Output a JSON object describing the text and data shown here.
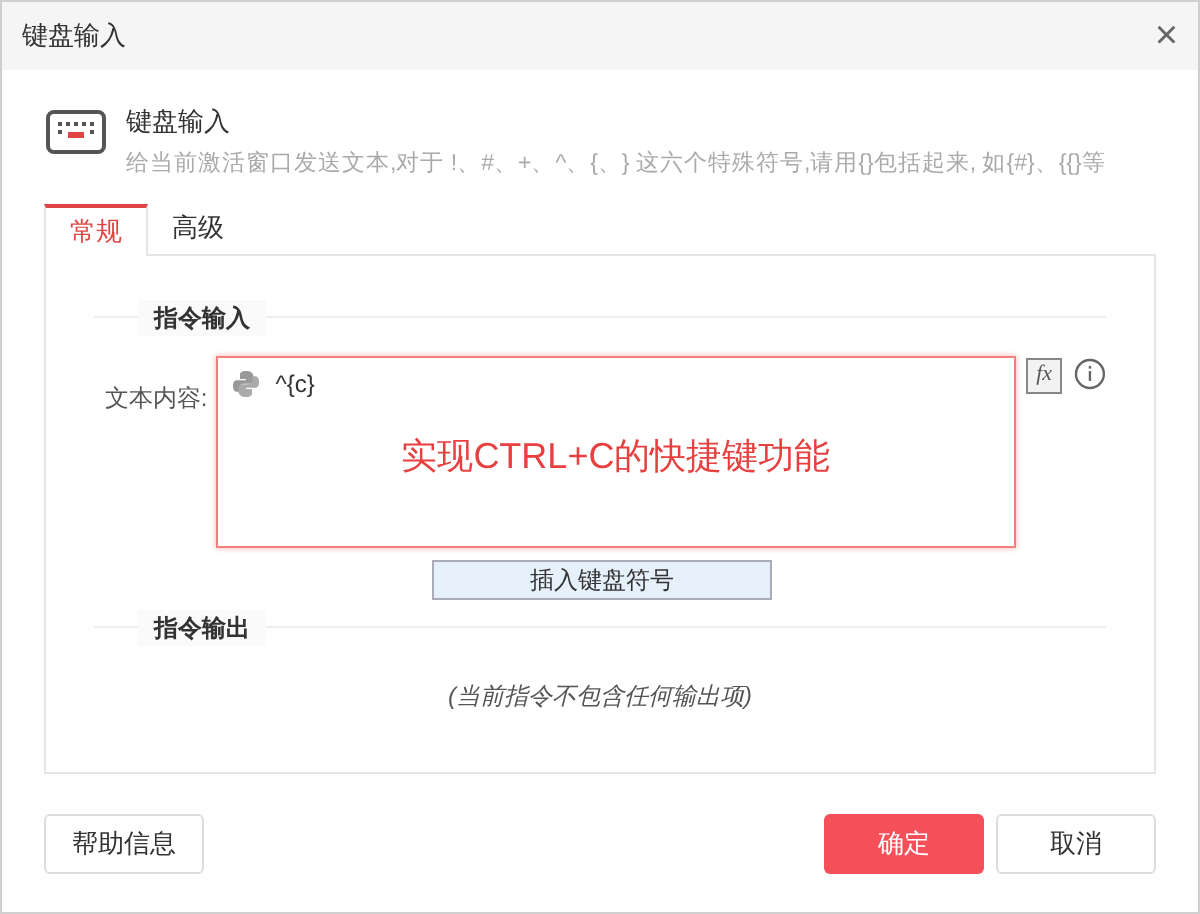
{
  "window": {
    "title": "键盘输入",
    "close": "×"
  },
  "header": {
    "title": "键盘输入",
    "description": "给当前激活窗口发送文本,对于 !、#、+、^、{、} 这六个特殊符号,请用{}包括起来, 如{#}、{{}等"
  },
  "tabs": [
    {
      "label": "常规",
      "selected": true
    },
    {
      "label": "高级",
      "selected": false
    }
  ],
  "input_section": {
    "title": "指令输入",
    "field_label": "文本内容:",
    "value": "^{c}",
    "annotation": "实现CTRL+C的快捷键功能",
    "insert_button": "插入键盘符号",
    "formula_button": "fx"
  },
  "output_section": {
    "title": "指令输出",
    "empty_text": "(当前指令不包含任何输出项)"
  },
  "buttons": [
    {
      "label": "帮助信息",
      "kind": "plain"
    },
    {
      "label": "确定",
      "kind": "primary"
    },
    {
      "label": "取消",
      "kind": "plain"
    }
  ]
}
